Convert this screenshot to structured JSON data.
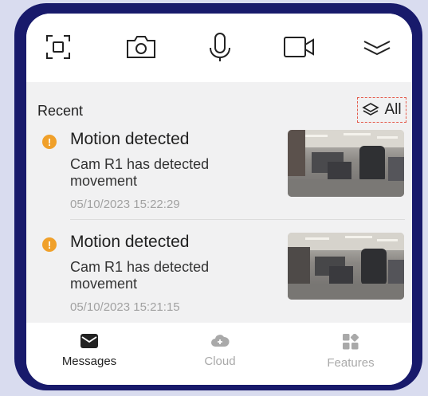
{
  "toolbar": {
    "icons": [
      "scan-icon",
      "camera-icon",
      "microphone-icon",
      "video-icon",
      "collapse-icon"
    ]
  },
  "recent": {
    "label": "Recent",
    "filter_label": "All"
  },
  "events": [
    {
      "title": "Motion detected",
      "description": "Cam R1 has detected movement",
      "timestamp": "05/10/2023 15:22:29"
    },
    {
      "title": "Motion detected",
      "description": "Cam R1 has detected movement",
      "timestamp": "05/10/2023 15:21:15"
    }
  ],
  "tabs": [
    {
      "label": "Messages",
      "icon": "envelope-icon",
      "active": true
    },
    {
      "label": "Cloud",
      "icon": "cloud-icon",
      "active": false
    },
    {
      "label": "Features",
      "icon": "grid-icon",
      "active": false
    }
  ],
  "colors": {
    "frame": "#181a6b",
    "background": "#d9dcef",
    "warning": "#f0a02a",
    "highlight_border": "#e4594a",
    "tab_active": "#222222",
    "tab_inactive": "#a9a9a9"
  }
}
